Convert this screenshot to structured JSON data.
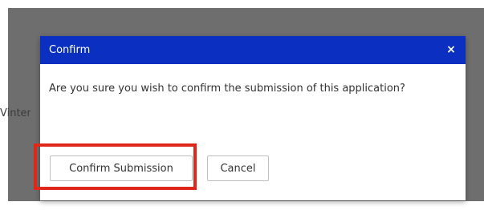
{
  "background": {
    "partial_text": "Vinter"
  },
  "dialog": {
    "title": "Confirm",
    "close_glyph": "×",
    "message": "Are you sure you wish to confirm the submission of this application?",
    "confirm_label": "Confirm Submission",
    "cancel_label": "Cancel"
  },
  "colors": {
    "header": "#0a2fc1",
    "overlay": "#6e6e6e",
    "highlight": "#e0281a"
  }
}
